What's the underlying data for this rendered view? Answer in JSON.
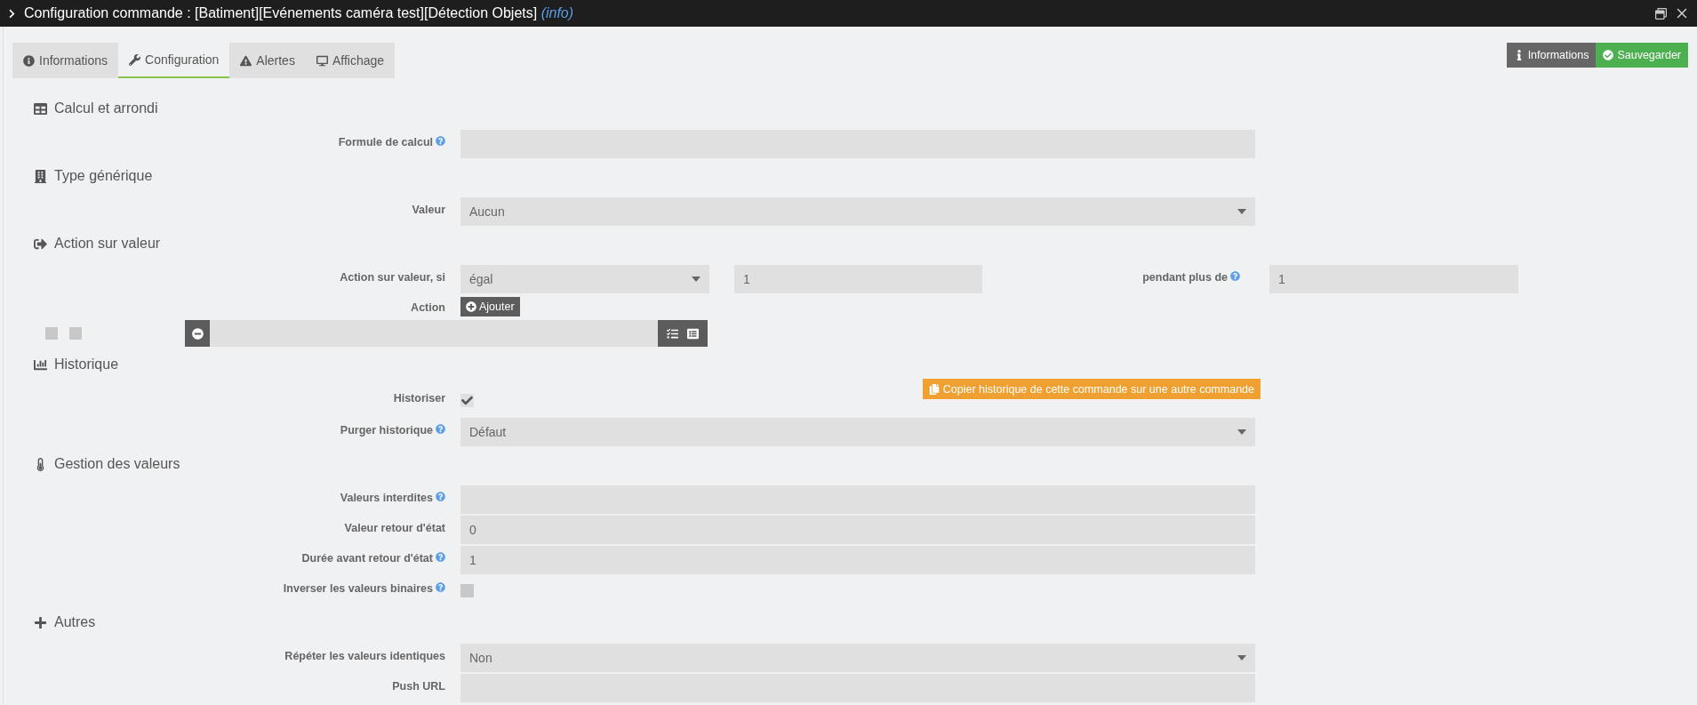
{
  "window": {
    "title": "Configuration commande : [Batiment][Evénements caméra test][Détection Objets]",
    "title_link": "(info)"
  },
  "tabs": [
    {
      "label": "Informations",
      "selected": false
    },
    {
      "label": "Configuration",
      "selected": true
    },
    {
      "label": "Alertes",
      "selected": false
    },
    {
      "label": "Affichage",
      "selected": false
    }
  ],
  "header_buttons": [
    {
      "label": "Informations",
      "kind": "info"
    },
    {
      "label": "Sauvegarder",
      "kind": "save"
    }
  ],
  "sections": [
    {
      "title": "Calcul et arrondi",
      "rows": [
        {
          "kind": "input",
          "label": "Formule de calcul",
          "help": true
        }
      ]
    },
    {
      "title": "Type générique",
      "rows": [
        {
          "kind": "select",
          "label": "Valeur",
          "help": false,
          "value": "Aucun"
        }
      ]
    },
    {
      "title": "Action sur valeur",
      "rows": [
        {
          "kind": "condition",
          "label": "Action sur valeur, si",
          "help": false,
          "operator": "égal",
          "value": "1",
          "duration_label": "pendant plus de",
          "duration_help": true,
          "duration": "1"
        },
        {
          "kind": "add",
          "label": "Action",
          "help": false,
          "button": "Ajouter"
        },
        {
          "kind": "action_line"
        }
      ]
    },
    {
      "title": "Historique",
      "rows": [
        {
          "kind": "checkbox",
          "label": "Historiser",
          "help": false,
          "checked": true,
          "button": "Copier historique de cette commande sur une autre commande"
        },
        {
          "kind": "select",
          "label": "Purger historique",
          "help": true,
          "value": "Défaut"
        }
      ]
    },
    {
      "title": "Gestion des valeurs",
      "rows": [
        {
          "kind": "input",
          "label": "Valeurs interdites",
          "help": true
        },
        {
          "kind": "input",
          "label": "Valeur retour d'état",
          "help": false,
          "value": "0"
        },
        {
          "kind": "input",
          "label": "Durée avant retour d'état",
          "help": true,
          "value": "1"
        },
        {
          "kind": "checkbox",
          "label": "Inverser les valeurs binaires",
          "help": true,
          "checked": false
        }
      ]
    },
    {
      "title": "Autres",
      "rows": [
        {
          "kind": "select",
          "label": "Répéter les valeurs identiques",
          "help": false,
          "value": "Non"
        },
        {
          "kind": "input",
          "label": "Push URL",
          "help": false
        }
      ]
    }
  ]
}
